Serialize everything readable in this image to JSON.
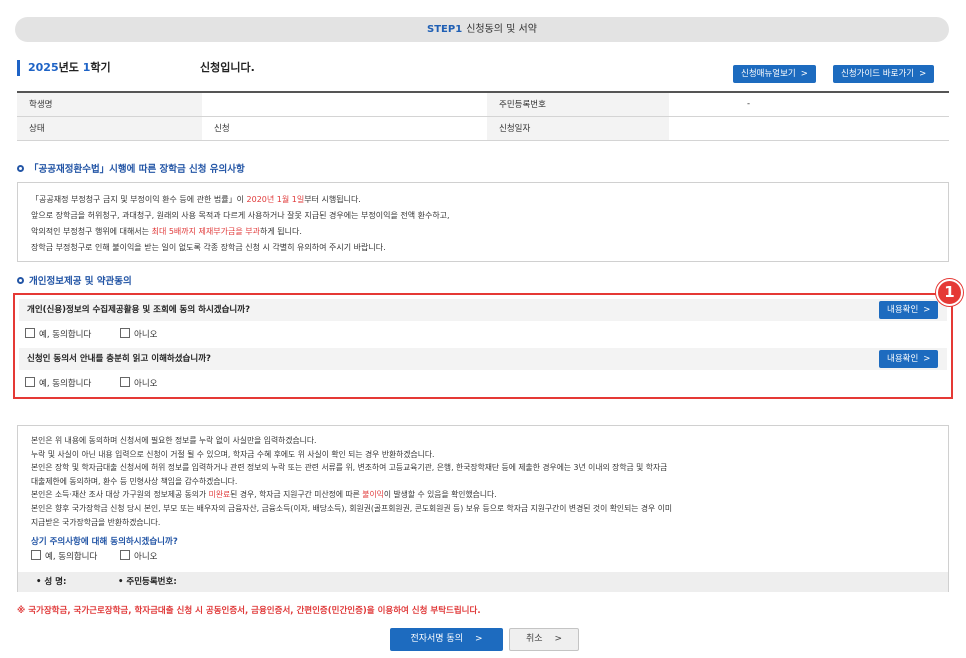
{
  "step": {
    "label": "STEP1",
    "title": "신청동의 및 서약"
  },
  "semester": {
    "year": "2025",
    "year_suffix": "년도 ",
    "term": "1",
    "term_suffix": "학기",
    "status_text": "신청입니다."
  },
  "buttons": {
    "manual": "신청매뉴얼보기",
    "guide": "신청가이드 바로가기",
    "detail": "내용확인",
    "sign": "전자서명 동의",
    "cancel": "취소"
  },
  "info_table": {
    "rows": [
      {
        "label1": "학생명",
        "value1": "",
        "label2": "주민등록번호",
        "value2": "-"
      },
      {
        "label1": "상태",
        "value1": "신청",
        "label2": "신청일자",
        "value2": ""
      }
    ]
  },
  "notice": {
    "title": "「공공재정환수법」시행에 따른 장학금 신청 유의사항",
    "line1_a": "「공공재정 부정청구 금지 및 부정이익 환수 등에 관한 법률」이 ",
    "line1_red": "2020년 1월 1일",
    "line1_b": "부터 시행됩니다.",
    "line2": "앞으로 장학금을 허위청구, 과대청구, 원래의 사용 목적과 다르게 사용하거나 잘못 지급된 경우에는 부정이익을 전액 환수하고,",
    "line3_a": "악의적인 부정청구 행위에 대해서는 ",
    "line3_red": "최대 5배까지 제재부가금을 부과",
    "line3_b": "하게 됩니다.",
    "line4": "장학금 부정청구로 인해 불이익을 받는 일이 없도록 각종 장학금 신청 시 각별히 유의하여 주시기 바랍니다."
  },
  "consent": {
    "title": "개인정보제공 및 약관동의",
    "marker": "1",
    "q1": "개인(신용)정보의 수집제공활용 및 조회에 동의 하시겠습니까?",
    "q2": "신청인 동의서 안내를 충분히 읽고 이해하셨습니까?",
    "yes": "예, 동의합니다",
    "no": "아니오"
  },
  "pledge": {
    "line1": "본인은 위 내용에 동의하며 신청서에 필요한 정보를 누락 없이 사실만을 입력하겠습니다.",
    "line2": "누락 및 사실이 아닌 내용 입력으로 신청이 거절 될 수 있으며, 학자금 수혜 후에도 위 사실이 확인 되는 경우 반환하겠습니다.",
    "line3": "본인은 장학 및 학자금대출 신청서에 허위 정보를 입력하거나 관련 정보의 누락 또는 관련 서류를 위, 변조하여 고등교육기관, 은행, 한국장학재단 등에 제출한 경우에는 3년 이내의 장학금 및 학자금",
    "line4": "대출제한에 동의하며, 환수 등 민형사상 책임을 감수하겠습니다.",
    "line5_a": "본인은 소득·재산 조사 대상 가구원의 정보제공 동의가 ",
    "line5_red1": "미완료",
    "line5_b": "된 경우, 학자금 지원구간 미산정에 따른 ",
    "line5_red2": "불이익",
    "line5_c": "이 발생할 수 있음을 확인했습니다.",
    "line6": "본인은 향후 국가장학금 신청 당시 본인, 부모 또는 배우자의 금융자산, 금융소득(이자, 배당소득), 회원권(골프회원권, 콘도회원권 등) 보유 등으로 학자금 지원구간이 변경된 것이 확인되는 경우 이미",
    "line7": "지급받은 국가장학금을 반환하겠습니다.",
    "question": "상기 주의사항에 대해 동의하시겠습니까?",
    "yes": "예, 동의합니다",
    "no": "아니오",
    "name_label": "• 성 명:",
    "rrn_label": "• 주민등록번호:"
  },
  "warning": "※ 국가장학금, 국가근로장학금, 학자금대출 신청 시 공동인증서, 금융인증서, 간편인증(민간인증)을 이용하여 신청 부탁드립니다."
}
